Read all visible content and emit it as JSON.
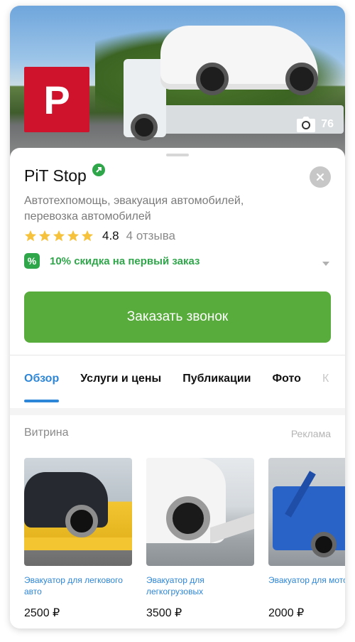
{
  "hero": {
    "photo_count": "76"
  },
  "logo": {
    "letter": "P"
  },
  "business": {
    "name": "PiT Stop",
    "description": "Автотехпомощь, эвакуация автомобилей, перевозка автомобилей",
    "rating": "4.8",
    "reviews": "4 отзыва",
    "stars": 5
  },
  "promo": {
    "icon_text": "%",
    "text": "10% скидка на первый заказ"
  },
  "cta": {
    "label": "Заказать звонок"
  },
  "tabs": [
    {
      "label": "Обзор",
      "active": true
    },
    {
      "label": "Услуги и цены",
      "active": false
    },
    {
      "label": "Публикации",
      "active": false
    },
    {
      "label": "Фото",
      "active": false
    },
    {
      "label": "К",
      "active": false
    }
  ],
  "showcase": {
    "title": "Витрина",
    "ad_label": "Реклама",
    "items": [
      {
        "name": "Эвакуатор для легкового авто",
        "price": "2500 ₽"
      },
      {
        "name": "Эвакуатор для легкогрузовых",
        "price": "3500 ₽"
      },
      {
        "name": "Эвакуатор для мотоциклов",
        "price": "2000 ₽"
      }
    ]
  },
  "colors": {
    "brand": "#d0132c",
    "accent_green": "#57ac3b",
    "link_blue": "#2d86d8",
    "promo_green": "#2fa64a",
    "star": "#f7c23b"
  },
  "icons": {
    "photo": "camera-icon",
    "verified": "verified-icon",
    "close": "close-icon",
    "star": "star-icon",
    "promo": "discount-icon",
    "chevron": "chevron-down-icon"
  }
}
